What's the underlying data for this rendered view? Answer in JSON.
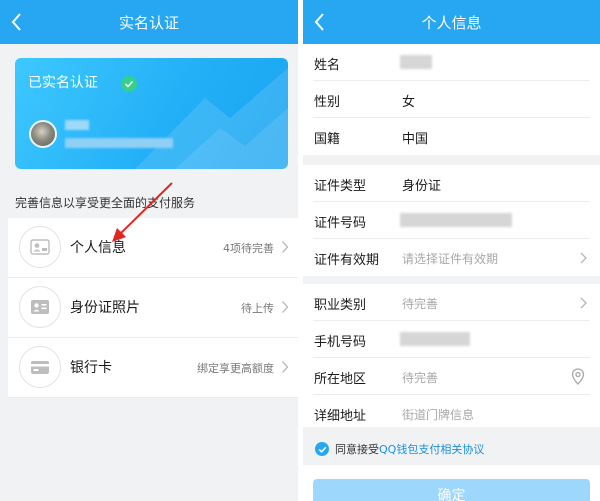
{
  "left": {
    "navbar": {
      "title": "实名认证"
    },
    "card": {
      "status_title": "已实名认证"
    },
    "hint": "完善信息以享受更全面的支付服务",
    "menu": [
      {
        "icon": "id-person-icon",
        "label": "个人信息",
        "status": "4项待完善"
      },
      {
        "icon": "id-card-photo-icon",
        "label": "身份证照片",
        "status": "待上传"
      },
      {
        "icon": "bank-card-icon",
        "label": "银行卡",
        "status": "绑定享更高额度"
      }
    ]
  },
  "right": {
    "navbar": {
      "title": "个人信息"
    },
    "basic": [
      {
        "label": "姓名",
        "value": ""
      },
      {
        "label": "性别",
        "value": "女"
      },
      {
        "label": "国籍",
        "value": "中国"
      }
    ],
    "certificate": [
      {
        "label": "证件类型",
        "value": "身份证"
      },
      {
        "label": "证件号码",
        "value": ""
      },
      {
        "label": "证件有效期",
        "placeholder": "请选择证件有效期"
      }
    ],
    "extra": [
      {
        "label": "职业类别",
        "placeholder": "待完善"
      },
      {
        "label": "手机号码",
        "value": ""
      },
      {
        "label": "所在地区",
        "placeholder": "待完善"
      },
      {
        "label": "详细地址",
        "placeholder": "街道门牌信息"
      }
    ],
    "agreement": {
      "prefix": "同意接受",
      "link": "QQ钱包支付相关协议"
    },
    "confirm_label": "确定"
  },
  "colors": {
    "accent": "#27a7f2",
    "verified": "#35d08b",
    "arrow": "#e0271f"
  }
}
